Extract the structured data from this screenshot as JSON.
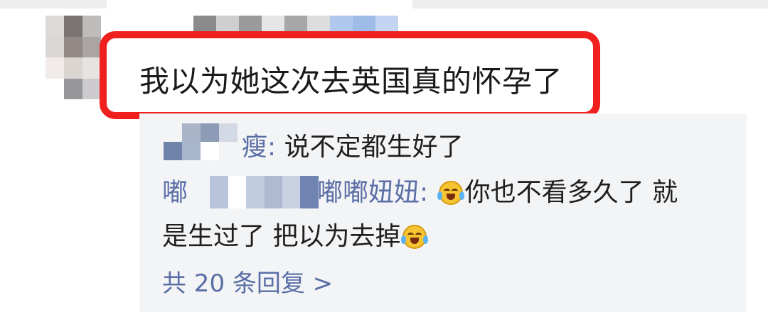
{
  "comment": {
    "text": "我以为她这次去英国真的怀孕了"
  },
  "replies": [
    {
      "name_visible": "瘦",
      "colon": ":",
      "text": "说不定都生好了"
    },
    {
      "name_prefix_visible": "嘟",
      "name_suffix_visible": "嘟嘟妞妞",
      "colon": ":",
      "text_part1": "你也不看多久了 就",
      "text_line2": "是生过了 把以为去掉",
      "emoji_name": "tears-of-joy-emoji"
    }
  ],
  "more_replies": {
    "label": "共 20 条回复 >"
  },
  "colors": {
    "highlight_border": "#f0201e",
    "link_blue": "#5b6ea6",
    "reply_bg": "#f3f4f6",
    "text": "#1a1a1a"
  }
}
